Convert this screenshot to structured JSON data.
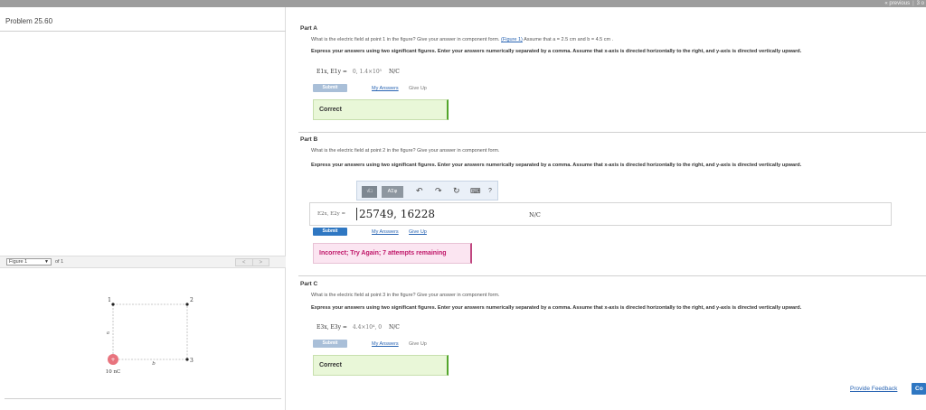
{
  "nav": {
    "previous": "« previous",
    "separator": "|",
    "page": "3 o"
  },
  "problem": {
    "title": "Problem 25.60"
  },
  "figure": {
    "select_label": "Figure 1",
    "of_text": "of 1",
    "prev": "<",
    "next": ">",
    "labels": {
      "p1": "1",
      "p2": "2",
      "p3": "3",
      "a": "a",
      "b": "b",
      "charge": "10 nC",
      "plus": "+"
    }
  },
  "partA": {
    "title": "Part A",
    "question": "What is the electric field at point 1 in the figure? Give your answer in component form.",
    "figure_link": "(Figure 1)",
    "assumption": "Assume that a = 2.5 cm and b = 4.5 cm .",
    "instruction": "Express your answers using two significant figures. Enter your answers numerically separated by a comma. Assume that x-axis is directed horizontally to the right, and y-axis is directed vertically upward.",
    "answer_label": "E1x, E1y =",
    "answer_value": "0, 1.4×10⁵",
    "answer_unit": "N/C",
    "submit": "Submit",
    "my_answers": "My Answers",
    "give_up": "Give Up",
    "feedback": "Correct"
  },
  "partB": {
    "title": "Part B",
    "question": "What is the electric field at point 2 in the figure? Give your answer in component form.",
    "instruction": "Express your answers using two significant figures. Enter your answers numerically separated by a comma. Assume that x-axis is directed horizontally to the right, and y-axis is directed vertically upward.",
    "toolbar": {
      "template": "√□",
      "greek": "ΑΣφ",
      "undo": "↶",
      "redo": "↷",
      "reset": "↻",
      "keyboard": "⌨",
      "help": "?"
    },
    "answer_label": "E2x, E2y =",
    "input_value": "25749, 16228",
    "answer_unit": "N/C",
    "submit": "Submit",
    "my_answers": "My Answers",
    "give_up": "Give Up",
    "feedback": "Incorrect; Try Again; 7 attempts remaining"
  },
  "partC": {
    "title": "Part C",
    "question": "What is the electric field at point 3 in the figure? Give your answer in component form.",
    "instruction": "Express your answers using two significant figures. Enter your answers numerically separated by a comma. Assume that x-axis is directed horizontally to the right, and y-axis is directed vertically upward.",
    "answer_label": "E3x, E3y =",
    "answer_value": "4.4×10⁴, 0",
    "answer_unit": "N/C",
    "submit": "Submit",
    "my_answers": "My Answers",
    "give_up": "Give Up",
    "feedback": "Correct"
  },
  "footer": {
    "provide_feedback": "Provide Feedback",
    "continue": "Co"
  },
  "colors": {
    "correct_bg": "#e9f7d8",
    "incorrect_bg": "#fbe5f1",
    "incorrect_text": "#c01769",
    "link": "#2a65b3",
    "submit": "#2f77c2",
    "charge": "#e8747e"
  }
}
